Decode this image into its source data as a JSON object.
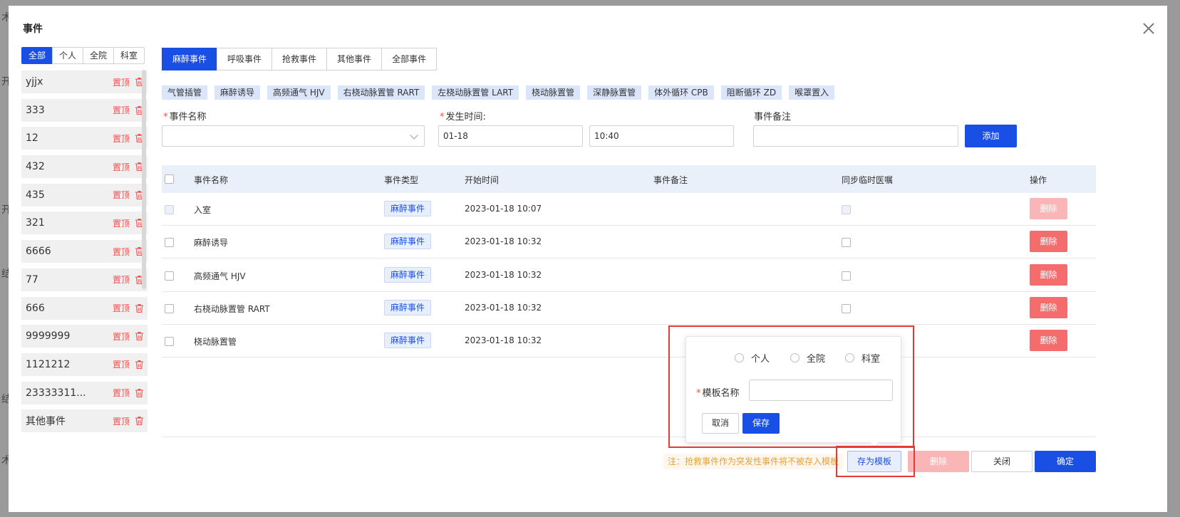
{
  "dialog": {
    "title": "事件"
  },
  "scope_tabs": [
    "全部",
    "个人",
    "全院",
    "科室"
  ],
  "templates": {
    "pin_label": "置顶",
    "items": [
      "yjjx",
      "333",
      "12",
      "432",
      "435",
      "321",
      "6666",
      "77",
      "666",
      "9999999",
      "23333311...",
      "其他事件"
    ],
    "extra_first": "1121212"
  },
  "event_tabs": [
    "麻醉事件",
    "呼吸事件",
    "抢救事件",
    "其他事件",
    "全部事件"
  ],
  "quick_events": [
    "气管插管",
    "麻醉诱导",
    "高频通气 HJV",
    "右桡动脉置管 RART",
    "左桡动脉置管 LART",
    "桡动脉置管",
    "深静脉置管",
    "体外循环 CPB",
    "阻断循环 ZD",
    "喉罩置入"
  ],
  "form": {
    "event_name_label": "事件名称",
    "time_label": "发生时间:",
    "date_value": "01-18",
    "time_value": "10:40",
    "note_label": "事件备注",
    "add_button": "添加"
  },
  "table": {
    "headers": [
      "事件名称",
      "事件类型",
      "开始时间",
      "事件备注",
      "同步临时医嘱",
      "操作"
    ],
    "rows": [
      {
        "name": "入室",
        "type": "麻醉事件",
        "time": "2023-01-18 10:07",
        "note": "",
        "locked": true
      },
      {
        "name": "麻醉诱导",
        "type": "麻醉事件",
        "time": "2023-01-18 10:32",
        "note": "",
        "locked": false
      },
      {
        "name": "高频通气 HJV",
        "type": "麻醉事件",
        "time": "2023-01-18 10:32",
        "note": "",
        "locked": false
      },
      {
        "name": "右桡动脉置管 RART",
        "type": "麻醉事件",
        "time": "2023-01-18 10:32",
        "note": "",
        "locked": false
      },
      {
        "name": "桡动脉置管",
        "type": "麻醉事件",
        "time": "2023-01-18 10:32",
        "note": "",
        "locked": false
      }
    ],
    "delete_label": "删除"
  },
  "popover": {
    "scopes": [
      "个人",
      "全院",
      "科室"
    ],
    "name_label": "模板名称",
    "cancel": "取消",
    "save": "保存"
  },
  "footer": {
    "note": "注：抢救事件作为突发性事件将不被存入模板",
    "save_template": "存为模板",
    "delete": "删除",
    "close": "关闭",
    "confirm": "确定"
  },
  "colors": {
    "primary": "#1a4fe6",
    "danger": "#f56c6c",
    "highlight": "#e53935",
    "warning": "#e6a23c"
  }
}
